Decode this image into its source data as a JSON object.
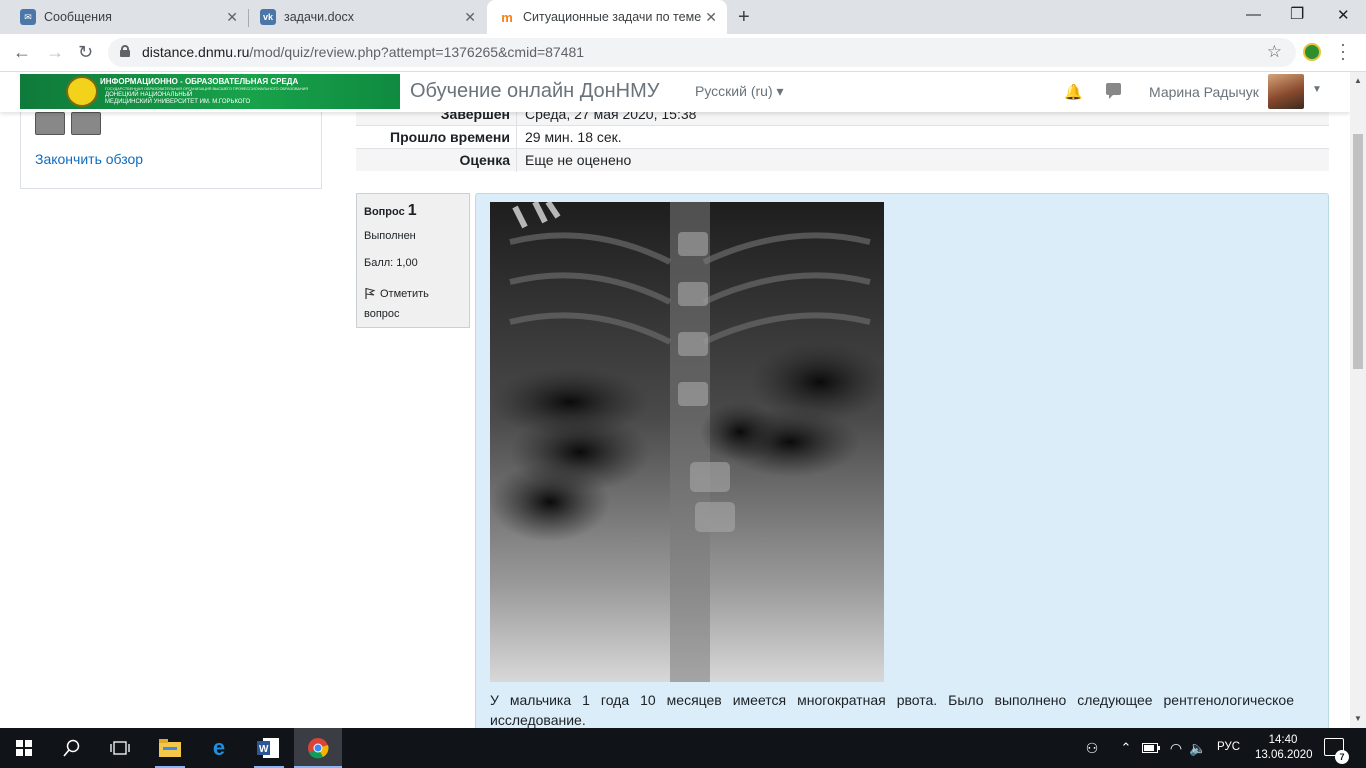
{
  "browser": {
    "tabs": [
      {
        "title": "Сообщения",
        "favicon": "vk-messages-icon",
        "color": "#4a76a8"
      },
      {
        "title": "задачи.docx",
        "favicon": "vk-icon",
        "color": "#4a76a8"
      },
      {
        "title": "Ситуационные задачи по теме",
        "favicon": "moodle-icon",
        "color": "#f98012"
      }
    ],
    "url_host": "distance.dnmu.ru",
    "url_path": "/mod/quiz/review.php?attempt=1376265&cmid=87481"
  },
  "navbar": {
    "logo_line1": "ИНФОРМАЦИОННО - ОБРАЗОВАТЕЛЬНАЯ СРЕДА",
    "logo_line2": "ГОСУДАРСТВЕННАЯ ОБРАЗОВАТЕЛЬНАЯ ОРГАНИЗАЦИЯ ВЫСШЕГО ПРОФЕССИОНАЛЬНОГО ОБРАЗОВАНИЯ",
    "logo_line3": "ДОНЕЦКИЙ НАЦИОНАЛЬНЫЙ",
    "logo_line4": "МЕДИЦИНСКИЙ УНИВЕРСИТЕТ ИМ. М.ГОРЬКОГО",
    "site_name": "Обучение онлайн ДонНМУ",
    "language": "Русский (ru)",
    "user_name": "Марина Радычук"
  },
  "left_block": {
    "finish_review": "Закончить обзор"
  },
  "summary": [
    {
      "label": "Завершен",
      "value": "Среда, 27 мая 2020, 15:38"
    },
    {
      "label": "Прошло времени",
      "value": "29 мин. 18 сек."
    },
    {
      "label": "Оценка",
      "value": "Еще не оценено"
    }
  ],
  "question": {
    "label": "Вопрос",
    "number": "1",
    "state": "Выполнен",
    "grade": "Балл: 1,00",
    "flag": "Отметить вопрос",
    "text": "У мальчика 1 года 10 месяцев имеется многократная рвота. Было выполнено следующее рентгенологическое исследование."
  },
  "taskbar": {
    "language": "РУС",
    "time": "14:40",
    "date": "13.06.2020",
    "notifications": "7"
  }
}
